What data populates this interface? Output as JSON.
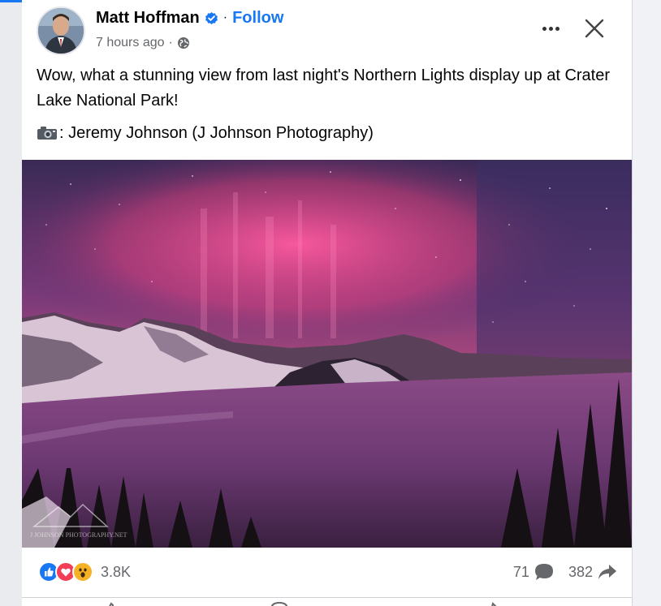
{
  "post": {
    "author": {
      "name": "Matt Hoffman",
      "verified": true
    },
    "follow_label": "Follow",
    "separator": "·",
    "timestamp": "7 hours ago",
    "timestamp_separator": "·",
    "audience_icon": "globe-icon",
    "text": "Wow, what a stunning view from last night's Northern Lights display up at Crater Lake National Park!",
    "caption": ": Jeremy Johnson (J Johnson Photography)",
    "caption_icon": "camera-icon",
    "photo": {
      "description_icon": "aurora-photo",
      "watermark": "J JOHNSON PHOTOGRAPHY.NET"
    }
  },
  "reactions": {
    "icons": [
      "like-icon",
      "love-icon",
      "wow-icon"
    ],
    "count": "3.8K"
  },
  "stats": {
    "comments": "71",
    "shares": "382"
  },
  "colors": {
    "accent": "#1877f2",
    "text": "#050505",
    "secondary": "#65676b",
    "love": "#f33e58",
    "wow": "#f7b125"
  }
}
